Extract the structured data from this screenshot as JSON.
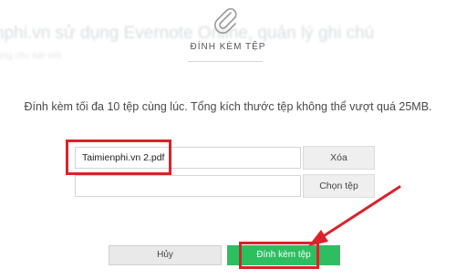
{
  "background": {
    "title": "nphi.vn sử dụng Evernote Online, quản lý ghi chú",
    "subtitle": "ưng cho bài viết"
  },
  "modal": {
    "icon": "paperclip-icon",
    "title": "ĐÍNH KÈM TỆP",
    "description": "Đính kèm tối đa 10 tệp cùng lúc. Tổng kích thước tệp không thể vượt quá 25MB.",
    "files": [
      {
        "name": "Taimienphi.vn 2.pdf",
        "action_label": "Xóa"
      },
      {
        "name": "",
        "action_label": "Chọn tệp"
      }
    ],
    "cancel_label": "Hủy",
    "attach_label": "Đính kèm tệp"
  },
  "colors": {
    "accent_green": "#2dbe60",
    "highlight_red": "#d9232a"
  }
}
